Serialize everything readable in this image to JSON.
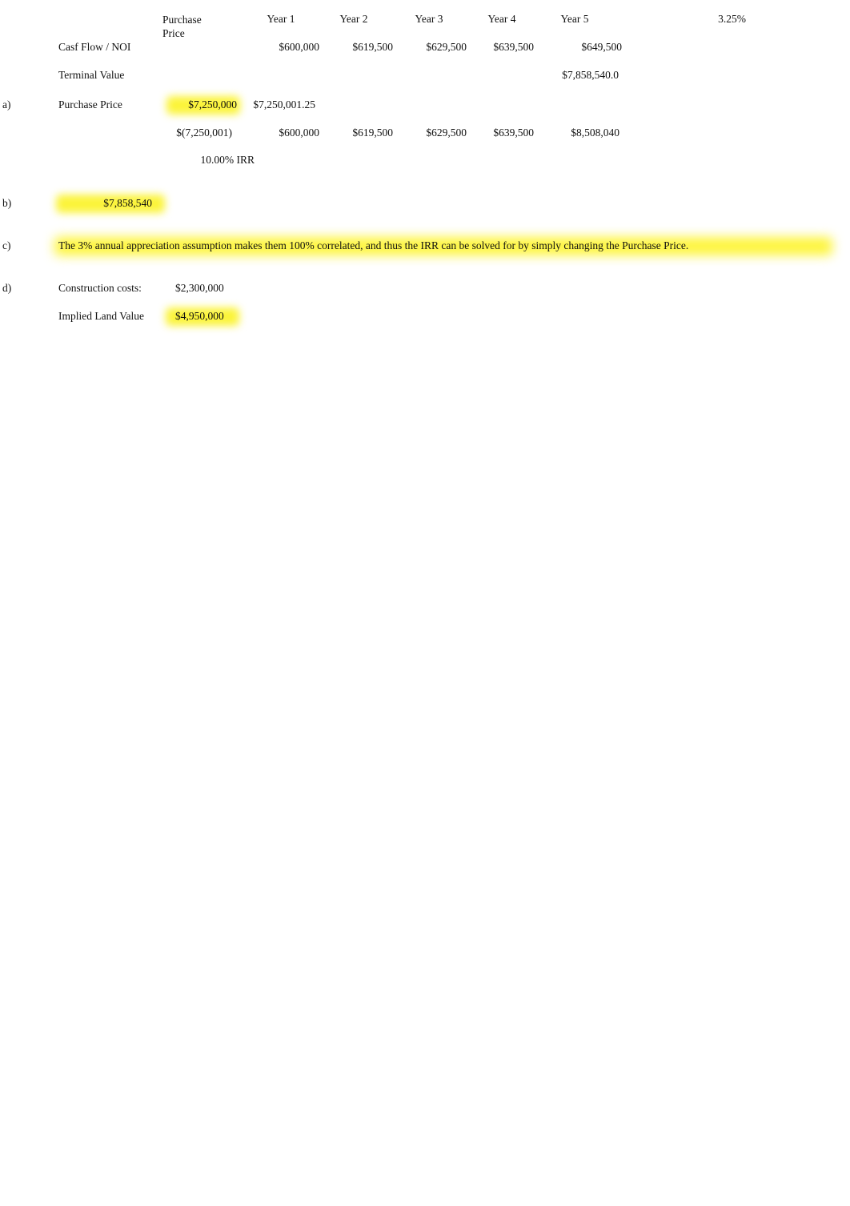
{
  "document": {
    "type": "spreadsheet",
    "title": "Real Estate IRR / Implied Land Value Worksheet",
    "highlight_color": "#fbf43a",
    "text_color": "#111111"
  },
  "columns": {
    "purchase_price_header_line1": "Purchase",
    "purchase_price_header_line2": "Price",
    "year1": "Year 1",
    "year2": "Year 2",
    "year3": "Year 3",
    "year4": "Year 4",
    "year5": "Year 5",
    "growth_rate": "3.25%"
  },
  "rows": {
    "cash_flow": {
      "label": "Casf Flow / NOI",
      "year1": "$600,000",
      "year2": "$619,500",
      "year3": "$629,500",
      "year4": "$639,500",
      "year5": "$649,500"
    },
    "terminal_value": {
      "label": "Terminal Value",
      "year5": "$7,858,540.0"
    },
    "purchase_price": {
      "marker": "a)",
      "label": "Purchase Price",
      "value_rounded": "$7,250,000",
      "value_exact": "$7,250,001.25"
    },
    "cash_flow_stream": {
      "purchase_price": "$(7,250,001)",
      "year1": "$600,000",
      "year2": "$619,500",
      "year3": "$629,500",
      "year4": "$639,500",
      "year5": "$8,508,040"
    },
    "irr": {
      "value": "10.00% IRR"
    },
    "part_b": {
      "marker": "b)",
      "value": "$7,858,540"
    },
    "part_c": {
      "marker": "c)",
      "text": "The 3% annual appreciation assumption makes them 100% correlated, and thus the IRR can be solved for by simply changing the Purchase Price."
    },
    "part_d": {
      "marker": "d)",
      "construction_costs_label": "Construction costs:",
      "construction_costs_value": "$2,300,000",
      "implied_land_value_label": "Implied Land Value",
      "implied_land_value_value": "$4,950,000"
    }
  }
}
